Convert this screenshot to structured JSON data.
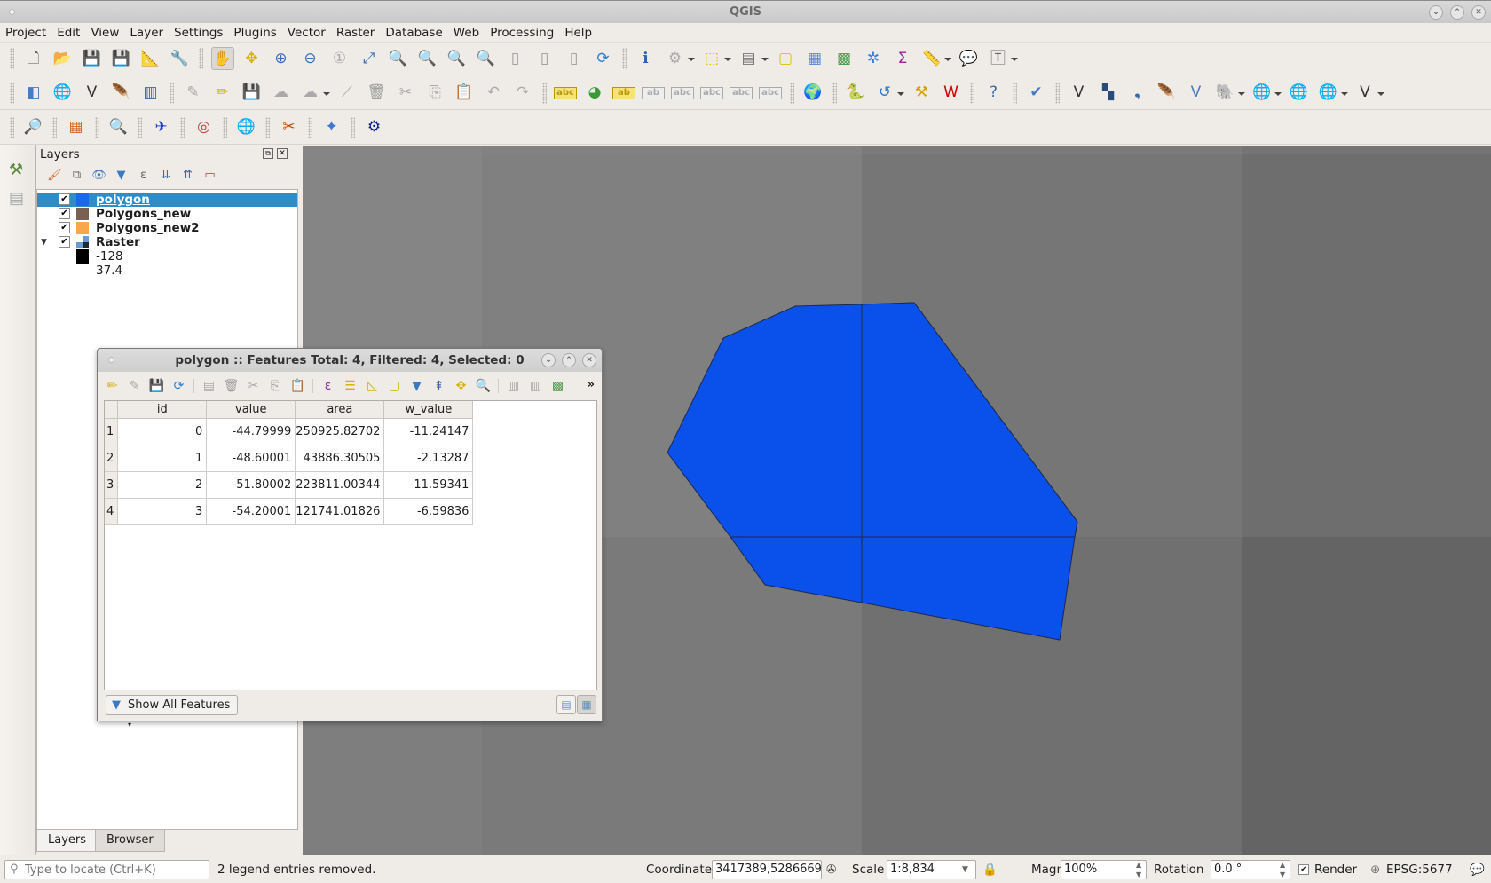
{
  "window": {
    "title": "QGIS"
  },
  "menu": [
    "Project",
    "Edit",
    "View",
    "Layer",
    "Settings",
    "Plugins",
    "Vector",
    "Raster",
    "Database",
    "Web",
    "Processing",
    "Help"
  ],
  "toolbars": {
    "row1": [
      {
        "name": "new-project-icon",
        "glyph": "🗋",
        "color": "#555"
      },
      {
        "name": "open-project-icon",
        "glyph": "📂",
        "color": "#e9c23a"
      },
      {
        "name": "save-project-icon",
        "glyph": "💾",
        "color": "#4b6ea5"
      },
      {
        "name": "save-as-icon",
        "glyph": "💾",
        "color": "#4b6ea5"
      },
      {
        "name": "new-print-layout-icon",
        "glyph": "📐",
        "color": "#c8a020"
      },
      {
        "name": "layout-manager-icon",
        "glyph": "🔧",
        "color": "#5a7aa8"
      },
      {
        "sep": true
      },
      {
        "name": "pan-map-icon",
        "glyph": "✋",
        "color": "#333",
        "sel": true
      },
      {
        "name": "pan-to-selection-icon",
        "glyph": "✥",
        "color": "#d4b500"
      },
      {
        "name": "zoom-in-icon",
        "glyph": "⊕",
        "color": "#3870b8"
      },
      {
        "name": "zoom-out-icon",
        "glyph": "⊖",
        "color": "#3870b8"
      },
      {
        "name": "zoom-native-icon",
        "glyph": "①",
        "color": "#aaa"
      },
      {
        "name": "zoom-full-icon",
        "glyph": "⤢",
        "color": "#3870b8"
      },
      {
        "name": "zoom-to-selection-icon",
        "glyph": "🔍",
        "color": "#c8b800"
      },
      {
        "name": "zoom-to-layer-icon",
        "glyph": "🔍",
        "color": "#777"
      },
      {
        "name": "zoom-last-icon",
        "glyph": "🔍",
        "color": "#3870b8"
      },
      {
        "name": "zoom-next-icon",
        "glyph": "🔍",
        "color": "#aaa"
      },
      {
        "name": "new-map-view-icon",
        "glyph": "▯",
        "color": "#999"
      },
      {
        "name": "new-bookmark-icon",
        "glyph": "▯",
        "color": "#999"
      },
      {
        "name": "show-bookmarks-icon",
        "glyph": "▯",
        "color": "#999"
      },
      {
        "name": "refresh-icon",
        "glyph": "⟳",
        "color": "#2f7fd0"
      },
      {
        "sep": true
      },
      {
        "name": "identify-features-icon",
        "glyph": "ℹ",
        "color": "#2a63b0"
      },
      {
        "name": "run-action-icon",
        "glyph": "⚙",
        "color": "#aaa",
        "dd": true
      },
      {
        "name": "select-features-icon",
        "glyph": "⬚",
        "color": "#e0c000",
        "dd": true
      },
      {
        "name": "select-by-value-icon",
        "glyph": "▤",
        "color": "#777",
        "dd": true
      },
      {
        "name": "deselect-all-icon",
        "glyph": "▢",
        "color": "#e0c000"
      },
      {
        "name": "open-attribute-table-icon",
        "glyph": "▦",
        "color": "#5a8ad0"
      },
      {
        "name": "field-calculator-icon",
        "glyph": "▩",
        "color": "#4a9a4a"
      },
      {
        "name": "processing-toolbox-icon",
        "glyph": "✲",
        "color": "#3d7fd1"
      },
      {
        "name": "statistical-summary-icon",
        "glyph": "Σ",
        "color": "#a0209a"
      },
      {
        "name": "measure-line-icon",
        "glyph": "📏",
        "color": "#666",
        "dd": true
      },
      {
        "name": "map-tips-icon",
        "glyph": "💬",
        "color": "#e6d200"
      },
      {
        "name": "text-annotation-icon",
        "glyph": "🅃",
        "color": "#666",
        "dd": true
      }
    ],
    "row2": [
      {
        "name": "data-source-manager-icon",
        "glyph": "◧",
        "color": "#4a7ac0"
      },
      {
        "name": "new-geopackage-layer-icon",
        "glyph": "🌐",
        "color": "#d0a020"
      },
      {
        "name": "new-shapefile-layer-icon",
        "glyph": "V",
        "color": "#333"
      },
      {
        "name": "new-spatialite-layer-icon",
        "glyph": "🪶",
        "color": "#3a6aa8"
      },
      {
        "name": "new-virtual-layer-icon",
        "glyph": "▥",
        "color": "#3a6aa8"
      },
      {
        "sep": true
      },
      {
        "name": "current-edits-icon",
        "glyph": "✎",
        "color": "#aaa"
      },
      {
        "name": "toggle-editing-icon",
        "glyph": "✏",
        "color": "#d4b000"
      },
      {
        "name": "save-edits-icon",
        "glyph": "💾",
        "color": "#aaa"
      },
      {
        "name": "add-polygon-feature-icon",
        "glyph": "☁",
        "color": "#aaa"
      },
      {
        "name": "move-feature-icon",
        "glyph": "☁",
        "color": "#aaa",
        "dd": true
      },
      {
        "name": "vertex-tool-icon",
        "glyph": "⟋",
        "color": "#aaa"
      },
      {
        "name": "delete-selected-icon",
        "glyph": "🗑",
        "color": "#999"
      },
      {
        "name": "cut-features-icon",
        "glyph": "✂",
        "color": "#aaa"
      },
      {
        "name": "copy-features-icon",
        "glyph": "⎘",
        "color": "#aaa"
      },
      {
        "name": "paste-features-icon",
        "glyph": "📋",
        "color": "#aaa"
      },
      {
        "name": "undo-icon",
        "glyph": "↶",
        "color": "#aaa"
      },
      {
        "name": "redo-icon",
        "glyph": "↷",
        "color": "#aaa"
      },
      {
        "sep": true
      },
      {
        "name": "layer-labeling-icon",
        "glyph": "abc",
        "color": "#b89800",
        "small": true
      },
      {
        "name": "layer-diagram-icon",
        "glyph": "◕",
        "color": "#3a9a3a"
      },
      {
        "name": "highlight-pinned-labels-icon",
        "glyph": "ab",
        "color": "#b89800",
        "small": true
      },
      {
        "name": "pin-labels-icon",
        "glyph": "ab",
        "color": "#aaa",
        "small": true
      },
      {
        "name": "show-hide-labels-icon",
        "glyph": "abc",
        "color": "#aaa",
        "small": true
      },
      {
        "name": "move-label-icon",
        "glyph": "abc",
        "color": "#aaa",
        "small": true
      },
      {
        "name": "rotate-label-icon",
        "glyph": "abc",
        "color": "#aaa",
        "small": true
      },
      {
        "name": "change-label-icon",
        "glyph": "abc",
        "color": "#aaa",
        "small": true
      },
      {
        "sep": true
      },
      {
        "name": "geo-search-icon",
        "glyph": "🌍",
        "color": "#333"
      },
      {
        "sep": true
      },
      {
        "name": "python-console-icon",
        "glyph": "🐍",
        "color": "#3a6aa8"
      },
      {
        "name": "plugin-reloader-icon",
        "glyph": "↺",
        "color": "#2a7ad0",
        "dd": true
      },
      {
        "name": "build-tool-icon",
        "glyph": "⚒",
        "color": "#d4a000"
      },
      {
        "name": "wkt-icon",
        "glyph": "W",
        "color": "#c00"
      },
      {
        "sep": true
      },
      {
        "name": "help-icon",
        "glyph": "?",
        "color": "#3a6aa8"
      },
      {
        "sep": true
      },
      {
        "name": "topology-checker-icon",
        "glyph": "✔",
        "color": "#4a7ac0"
      },
      {
        "sep": true
      },
      {
        "name": "add-vector-layer-icon",
        "glyph": "V",
        "color": "#333"
      },
      {
        "name": "add-raster-layer-icon",
        "glyph": "▚",
        "color": "#2a4a7a"
      },
      {
        "name": "add-delimited-text-icon",
        "glyph": "❟",
        "color": "#3a6aa8"
      },
      {
        "name": "add-spatialite-icon",
        "glyph": "🪶",
        "color": "#3a6aa8"
      },
      {
        "name": "add-virtual-layer-icon",
        "glyph": "V",
        "color": "#4a7ac0"
      },
      {
        "name": "add-postgis-icon",
        "glyph": "🐘",
        "color": "#3a6aa8",
        "dd": true
      },
      {
        "name": "add-wms-icon",
        "glyph": "🌐",
        "color": "#4a7ac0",
        "dd": true
      },
      {
        "name": "add-wcs-icon",
        "glyph": "🌐",
        "color": "#2a5a9a"
      },
      {
        "name": "add-wfs-icon",
        "glyph": "🌐",
        "color": "#4a7ac0",
        "dd": true
      },
      {
        "name": "new-temp-layer-icon",
        "glyph": "V",
        "color": "#333",
        "dd": true
      }
    ],
    "row3": [
      {
        "name": "geocoder-icon",
        "glyph": "🔎",
        "color": "#3a6aa8"
      },
      {
        "sep": true
      },
      {
        "name": "raster-heatmap-icon",
        "glyph": "▦",
        "color": "#d06a2a"
      },
      {
        "sep": true
      },
      {
        "name": "quick-search-icon",
        "glyph": "🔍",
        "color": "#e6c800"
      },
      {
        "sep": true
      },
      {
        "name": "flight-plugin-icon",
        "glyph": "✈",
        "color": "#1a3ad0"
      },
      {
        "sep": true
      },
      {
        "name": "spiral-plugin-icon",
        "glyph": "◎",
        "color": "#c03a3a"
      },
      {
        "sep": true
      },
      {
        "name": "wms-plugin-icon",
        "glyph": "🌐",
        "color": "#2a7a2a"
      },
      {
        "sep": true
      },
      {
        "name": "clipper-plugin-icon",
        "glyph": "✂",
        "color": "#c04a00"
      },
      {
        "sep": true
      },
      {
        "name": "galaxy-plugin-icon",
        "glyph": "✦",
        "color": "#3a7ad0"
      },
      {
        "sep": true
      },
      {
        "name": "settings-gear-plugin-icon",
        "glyph": "⚙",
        "color": "#0a1a8a"
      }
    ]
  },
  "layers_panel": {
    "title": "Layers",
    "tools": [
      "style-icon",
      "add-group-icon",
      "visibility-icon",
      "filter-icon",
      "expression-filter-icon",
      "expand-all-icon",
      "collapse-all-icon",
      "remove-layer-icon"
    ],
    "items": [
      {
        "name": "polygon",
        "checked": true,
        "color": "#1a6ae8",
        "selected": true
      },
      {
        "name": "Polygons_new",
        "checked": true,
        "color": "#7a6050"
      },
      {
        "name": "Polygons_new2",
        "checked": true,
        "color": "#f6a84a"
      },
      {
        "name": "Raster",
        "checked": true,
        "color": "raster",
        "expanded": true
      }
    ],
    "raster_legend": {
      "min": "-128",
      "max": "37.4"
    },
    "tabs": [
      "Layers",
      "Browser"
    ],
    "active_tab": "Layers"
  },
  "attribute_table": {
    "title": "polygon :: Features Total: 4, Filtered: 4, Selected: 0",
    "columns": [
      "id",
      "value",
      "area",
      "w_value"
    ],
    "rows": [
      {
        "row": "1",
        "id": "0",
        "value": "-44.79999",
        "area": "250925.82702",
        "w_value": "-11.24147"
      },
      {
        "row": "2",
        "id": "1",
        "value": "-48.60001",
        "area": "43886.30505",
        "w_value": "-2.13287"
      },
      {
        "row": "3",
        "id": "2",
        "value": "-51.80002",
        "area": "223811.00344",
        "w_value": "-11.59341"
      },
      {
        "row": "4",
        "id": "3",
        "value": "-54.20001",
        "area": "121741.01826",
        "w_value": "-6.59836"
      }
    ],
    "filter_button": "Show All Features",
    "more_label": "»"
  },
  "map": {
    "polygon_fill": "#0a50eb",
    "tile_colors": [
      "#858585",
      "#7d7d7d",
      "#727272",
      "#626262",
      "#7a7a7a",
      "#6f6f6f",
      "#5f5f5f"
    ]
  },
  "status": {
    "locator_placeholder": "Type to locate (Ctrl+K)",
    "message": "2 legend entries removed.",
    "coordinate_label": "Coordinate",
    "coordinate": "3417389,5286669",
    "scale_label": "Scale",
    "scale": "1:8,834",
    "magnifier_label": "Magnifier",
    "magnifier": "100%",
    "rotation_label": "Rotation",
    "rotation": "0.0 °",
    "render_label": "Render",
    "render_checked": true,
    "crs": "EPSG:5677"
  }
}
